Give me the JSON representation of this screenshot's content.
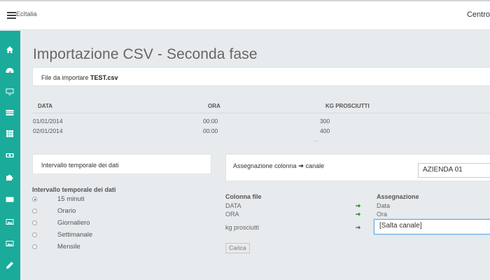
{
  "header": {
    "brand": "EcItalia",
    "right_text": "Centro"
  },
  "sidebar": {
    "items": [
      {
        "icon": "home-icon"
      },
      {
        "icon": "dashboard-icon"
      },
      {
        "icon": "monitor-icon"
      },
      {
        "icon": "list-icon"
      },
      {
        "icon": "grid-icon"
      },
      {
        "icon": "money-icon"
      },
      {
        "icon": "puzzle-icon"
      },
      {
        "icon": "envelope-icon"
      },
      {
        "icon": "image-icon"
      },
      {
        "icon": "image-icon"
      },
      {
        "icon": "pencil-icon"
      }
    ]
  },
  "page": {
    "title": "Importazione CSV - Seconda fase"
  },
  "file_panel": {
    "label": "File da importare",
    "filename": "TEST.csv"
  },
  "preview": {
    "headers": [
      "DATA",
      "ORA",
      "KG PROSCIUTTI"
    ],
    "rows": [
      [
        "01/01/2014",
        "00:00",
        "300"
      ],
      [
        "02/01/2014",
        "00:00",
        "400"
      ]
    ],
    "ellipsis": "..."
  },
  "interval_panel": {
    "label": "Intervallo temporale dei dati"
  },
  "interval_options": {
    "title": "Intervallo temporale dei dati",
    "selected": "15 minuti",
    "options": [
      "15 minuti",
      "Orario",
      "Giornaliero",
      "Settimanale",
      "Mensile"
    ]
  },
  "assign_panel": {
    "label_prefix": "Assegnazione colonna",
    "label_suffix": "canale",
    "company": "AZIENDA 01"
  },
  "mapping": {
    "col_file_header": "Colonna file",
    "assign_header": "Assegnazione",
    "rows": [
      {
        "file": "DATA",
        "assign": "Data"
      },
      {
        "file": "ORA",
        "assign": "Ora"
      },
      {
        "file": "kg prosciutti",
        "assign": "[Salta canale]"
      }
    ]
  },
  "actions": {
    "submit": "Carica"
  },
  "colors": {
    "sidebar": "#1aab9b",
    "arrow_green": "#2e8b2e",
    "arrow_gray": "#666666",
    "background": "#e7ebee"
  }
}
